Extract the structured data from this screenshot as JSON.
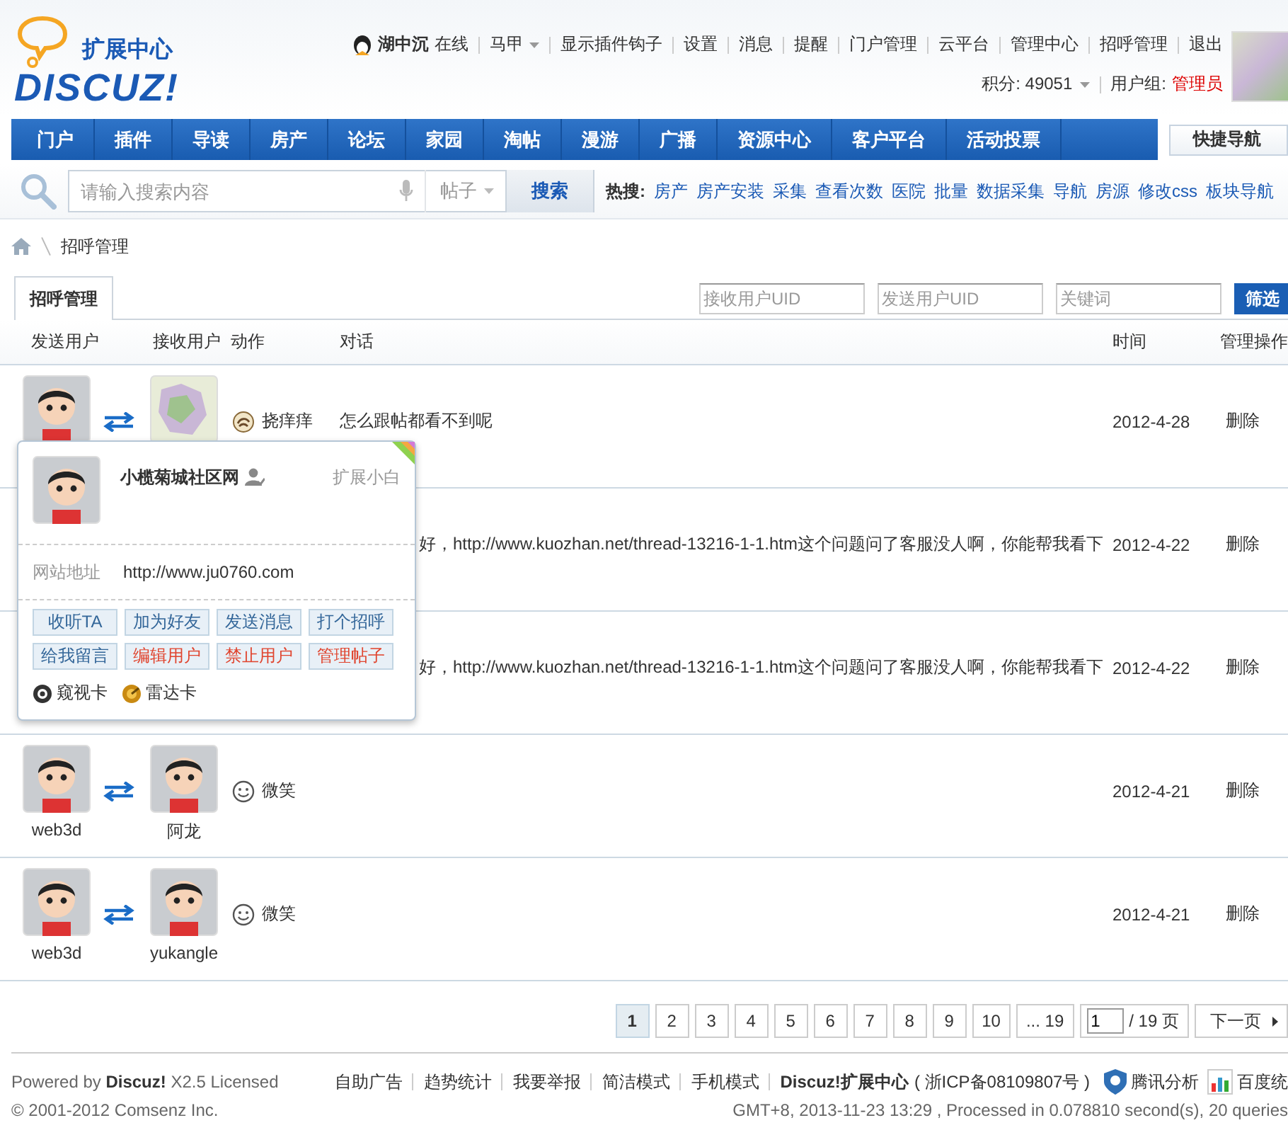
{
  "header": {
    "logo": {
      "subtitle": "扩展中心",
      "wordmark": "DISCUZ!"
    },
    "user": {
      "name": "湖中沉",
      "status": "在线",
      "vest": "马甲"
    },
    "links": [
      "显示插件钩子",
      "设置",
      "消息",
      "提醒",
      "门户管理",
      "云平台",
      "管理中心",
      "招呼管理",
      "退出"
    ],
    "credits": "积分: 49051",
    "group_label": "用户组:",
    "group": "管理员"
  },
  "nav": {
    "items": [
      {
        "label": "门户",
        "selected": false
      },
      {
        "label": "插件",
        "selected": false
      },
      {
        "label": "导读",
        "selected": false
      },
      {
        "label": "房产",
        "selected": false
      },
      {
        "label": "论坛",
        "selected": false
      },
      {
        "label": "家园",
        "selected": false
      },
      {
        "label": "淘帖",
        "selected": false
      },
      {
        "label": "漫游",
        "selected": false
      },
      {
        "label": "广播",
        "selected": false
      },
      {
        "label": "资源中心",
        "selected": false
      },
      {
        "label": "客户平台",
        "selected": false
      },
      {
        "label": "活动投票",
        "selected": false
      }
    ],
    "quick": "快捷导航"
  },
  "search": {
    "placeholder": "请输入搜索内容",
    "scope": "帖子",
    "button": "搜索",
    "hot_label": "热搜:",
    "hot": [
      "房产",
      "房产安装",
      "采集",
      "查看次数",
      "医院",
      "批量",
      "数据采集",
      "导航",
      "房源",
      "修改css",
      "板块导航"
    ]
  },
  "breadcrumb": [
    "招呼管理"
  ],
  "tabs": [
    {
      "label": "招呼管理",
      "selected": true
    }
  ],
  "filters": [
    {
      "placeholder": "接收用户UID"
    },
    {
      "placeholder": "发送用户UID"
    },
    {
      "placeholder": "关键词"
    }
  ],
  "filter_button": "筛选",
  "table": {
    "columns": [
      "发送用户",
      "接收用户",
      "动作",
      "对话",
      "时间",
      "管理操作"
    ],
    "rows": [
      {
        "sender": {
          "kind": "cartoon"
        },
        "receiver": {
          "kind": "photo"
        },
        "action": {
          "kind": "poke",
          "label": "挠痒痒"
        },
        "message": "怎么跟帖都看不到呢",
        "time": "2012-4-28",
        "op": "删除"
      },
      {
        "message": "好，http://www.kuozhan.net/thread-13216-1-1.htm这个问题问了客服没人啊，你能帮我看下",
        "time": "2012-4-22",
        "op": "删除"
      },
      {
        "message": "好，http://www.kuozhan.net/thread-13216-1-1.htm这个问题问了客服没人啊，你能帮我看下",
        "time": "2012-4-22",
        "op": "删除"
      },
      {
        "sender": {
          "kind": "cartoon",
          "name": "web3d"
        },
        "receiver": {
          "kind": "cartoon",
          "name": "阿龙"
        },
        "action": {
          "kind": "smile",
          "label": "微笑"
        },
        "time": "2012-4-21",
        "op": "删除"
      },
      {
        "sender": {
          "kind": "cartoon",
          "name": "web3d"
        },
        "receiver": {
          "kind": "cartoon",
          "name": "yukangle"
        },
        "action": {
          "kind": "smile",
          "label": "微笑"
        },
        "time": "2012-4-21",
        "op": "删除"
      }
    ]
  },
  "popup": {
    "name": "小榄菊城社区网",
    "group": "扩展小白",
    "site_label": "网站地址",
    "site": "http://www.ju0760.com",
    "actions": [
      {
        "label": "收听TA",
        "kind": "normal"
      },
      {
        "label": "加为好友",
        "kind": "normal"
      },
      {
        "label": "发送消息",
        "kind": "normal"
      },
      {
        "label": "打个招呼",
        "kind": "normal"
      },
      {
        "label": "给我留言",
        "kind": "normal"
      },
      {
        "label": "编辑用户",
        "kind": "admin"
      },
      {
        "label": "禁止用户",
        "kind": "admin"
      },
      {
        "label": "管理帖子",
        "kind": "admin"
      }
    ],
    "cards": [
      {
        "label": "窥视卡",
        "kind": "eye"
      },
      {
        "label": "雷达卡",
        "kind": "radar"
      }
    ]
  },
  "pagination": {
    "pages": [
      {
        "label": "1",
        "selected": true
      },
      {
        "label": "2",
        "selected": false
      },
      {
        "label": "3",
        "selected": false
      },
      {
        "label": "4",
        "selected": false
      },
      {
        "label": "5",
        "selected": false
      },
      {
        "label": "6",
        "selected": false
      },
      {
        "label": "7",
        "selected": false
      },
      {
        "label": "8",
        "selected": false
      },
      {
        "label": "9",
        "selected": false
      },
      {
        "label": "10",
        "selected": false
      }
    ],
    "last": "... 19",
    "jump_value": "1",
    "total": "/ 19 页",
    "next": "下一页"
  },
  "footer": {
    "powered": "Powered by **Discuz!** X2.5 Licensed",
    "copyright": "© 2001-2012 Comsenz Inc.",
    "links": [
      "自助广告",
      "趋势统计",
      "我要举报",
      "简洁模式",
      "手机模式"
    ],
    "site": "Discuz!扩展中心",
    "icp": "( 浙ICP备08109807号 )",
    "stats": [
      {
        "label": "腾讯分析",
        "kind": "shield"
      },
      {
        "label": "百度统",
        "kind": "chart"
      }
    ],
    "timing": "GMT+8, 2013-11-23 13:29 , Processed in 0.078810 second(s), 20 queries"
  }
}
